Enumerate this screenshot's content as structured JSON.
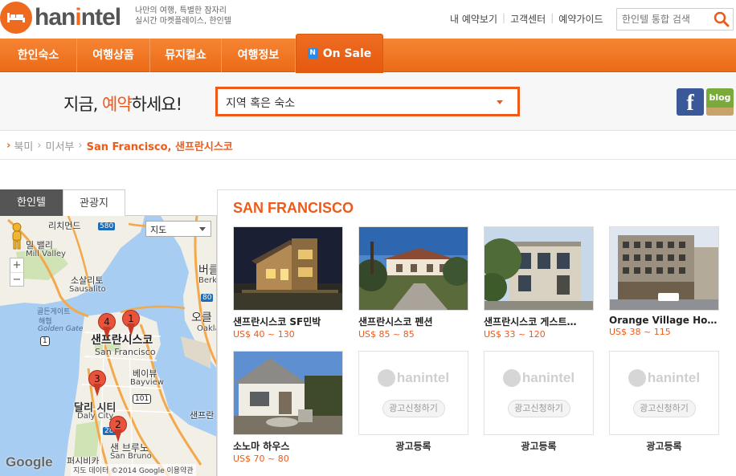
{
  "brand": {
    "name_left": "han",
    "name_o": "i",
    "name_right": "ntel",
    "tagline_line1": "나만의 여행, 특별한 잠자리",
    "tagline_line2": "실시간 마켓플레이스, 한인텔"
  },
  "top_links": [
    "내 예약보기",
    "고객센터",
    "예약가이드"
  ],
  "search": {
    "placeholder": "한인텔 통합 검색"
  },
  "nav": {
    "items": [
      "한인숙소",
      "여행상품",
      "뮤지컬쇼",
      "여행정보"
    ],
    "sale_badge": "N",
    "sale_label": "On Sale"
  },
  "reserve": {
    "title_pre": "지금, ",
    "title_hl": "예약",
    "title_post": "하세요!",
    "region_value": "지역 혹은 숙소"
  },
  "social": {
    "facebook": "f",
    "blog": "blog"
  },
  "breadcrumb": {
    "items": [
      "북미",
      "미서부"
    ],
    "current": "San Francisco, 샌프란시스코"
  },
  "left_tabs": {
    "active": "한인텔",
    "inactive": "관광지"
  },
  "map": {
    "type_select": "지도",
    "zoom_in": "+",
    "zoom_out": "−",
    "labels": {
      "mill_valley_ko": "밀 밸리",
      "mill_valley_en": "Mill Valley",
      "sausalito_ko": "소살리토",
      "sausalito_en": "Sausalito",
      "berkeley_ko": "버클",
      "berkeley_en": "Berke",
      "oakland_ko": "오클",
      "oakland_en": "Oakla",
      "richmond_ko": "리치먼드",
      "golden_gate_ko": "골든게이트",
      "golden_gate_ko2": "해협",
      "golden_gate_en": "Golden Gate",
      "sf_ko": "샌프란시스코",
      "sf_en": "San Francisco",
      "bayview_ko": "베이뷰",
      "bayview_en": "Bayview",
      "daly_ko": "달리 시티",
      "daly_en": "Daly City",
      "sanbruno_ko": "샌 브루노",
      "sanbruno_en": "San Bruno",
      "pacifica_ko": "퍼시비카",
      "sf_bay_ko": "샌프란"
    },
    "road_580": "580",
    "road_80": "80",
    "road_280": "280",
    "road_101": "101",
    "road_1": "1",
    "pins": [
      "1",
      "2",
      "3",
      "4"
    ],
    "google": "Google",
    "copyright": "지도 데이터 ©2014 Google  이용약관"
  },
  "listing": {
    "city": "SAN FRANCISCO",
    "cards": [
      {
        "name": "샌프란시스코 SF민박",
        "price": "US$ 40 ~ 130"
      },
      {
        "name": "샌프란시스코 펜션",
        "price": "US$ 85 ~ 85"
      },
      {
        "name": "샌프란시스코 게스트…",
        "price": "US$ 33 ~ 120"
      },
      {
        "name": "Orange Village Ho…",
        "price": "US$ 38 ~ 115"
      },
      {
        "name": "소노마 하우스",
        "price": "US$ 70 ~ 80"
      }
    ],
    "ads": [
      {
        "logo": "hanintel",
        "button": "광고신청하기",
        "label": "광고등록"
      },
      {
        "logo": "hanintel",
        "button": "광고신청하기",
        "label": "광고등록"
      },
      {
        "logo": "hanintel",
        "button": "광고신청하기",
        "label": "광고등록"
      }
    ]
  },
  "colors": {
    "accent": "#ee5a1a",
    "nav": "#f07a2a",
    "water": "#a8cdf2"
  }
}
